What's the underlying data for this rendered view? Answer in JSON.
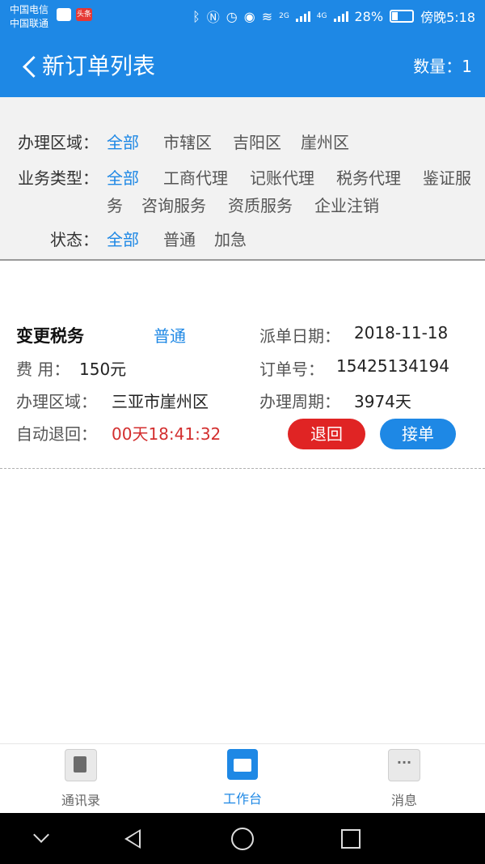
{
  "status_bar": {
    "carrier_1": "中国电信",
    "carrier_2": "中国联通",
    "news_badge": "头条",
    "network_2g": "2G",
    "network_4g": "4G",
    "battery": "28%",
    "time": "傍晚5:18"
  },
  "header": {
    "title": "新订单列表",
    "count_label": "数量：1"
  },
  "filters": {
    "area": {
      "label": "办理区域：",
      "options": [
        "全部",
        "市辖区",
        "吉阳区",
        "崖州区"
      ],
      "selected": "全部"
    },
    "business_type": {
      "label": "业务类型：",
      "options": [
        "全部",
        "工商代理",
        "记账代理",
        "税务代理",
        "鉴证服",
        "务",
        "咨询服务",
        "资质服务",
        "企业注销"
      ],
      "selected": "全部"
    },
    "status": {
      "label": "状态：",
      "options": [
        "全部",
        "普通",
        "加急"
      ],
      "selected": "全部"
    }
  },
  "order": {
    "name": "变更税务",
    "priority": "普通",
    "dispatch_date_label": "派单日期：",
    "dispatch_date": "2018-11-18",
    "fee_label": "费  用：",
    "fee": "150元",
    "order_no_label": "订单号：",
    "order_no": "15425134194",
    "area_label": "办理区域：",
    "area": "三亚市崖州区",
    "period_label": "办理周期：",
    "period": "3974天",
    "auto_return_label": "自动退回：",
    "auto_return_countdown": "00天18:41:32",
    "reject_button": "退回",
    "accept_button": "接单"
  },
  "bottom_nav": {
    "tabs": [
      {
        "label": "通讯录",
        "icon": "contacts-icon"
      },
      {
        "label": "工作台",
        "icon": "workbench-icon"
      },
      {
        "label": "消息",
        "icon": "message-icon"
      }
    ],
    "active": "工作台"
  },
  "colors": {
    "accent": "#1e88e5",
    "danger": "#e02424",
    "countdown": "#d32f2f"
  }
}
